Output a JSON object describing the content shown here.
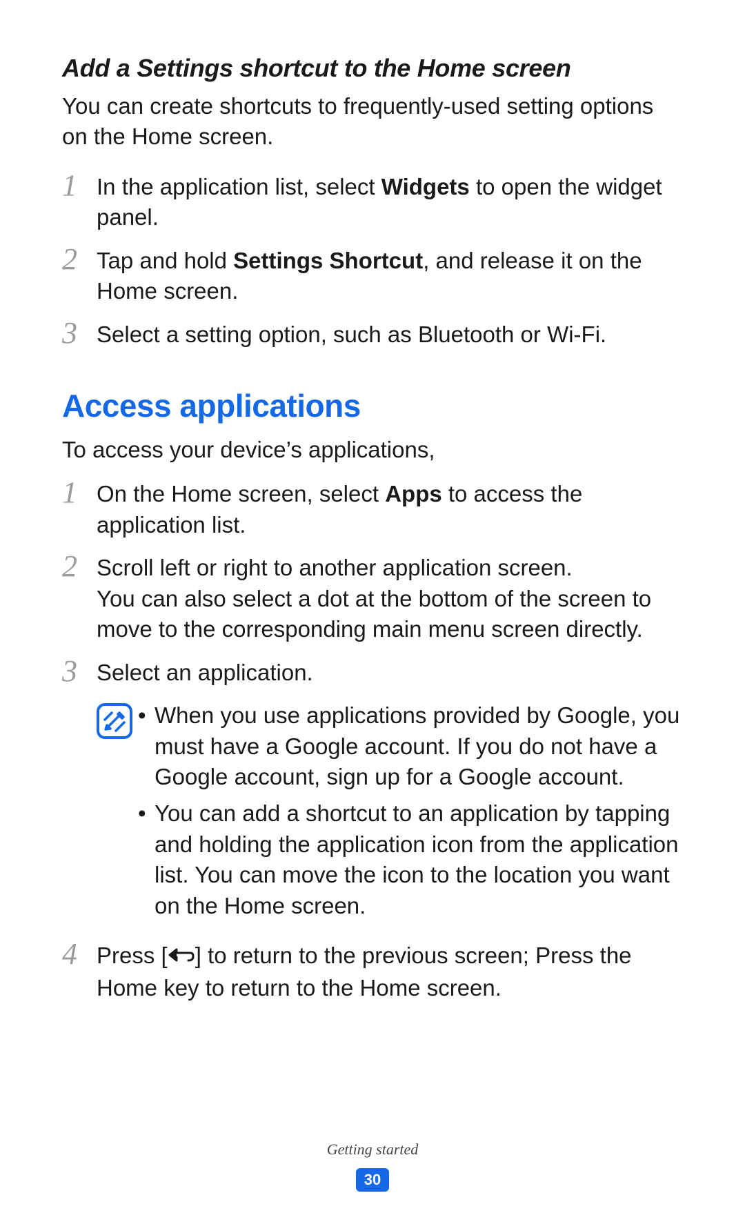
{
  "section1": {
    "heading": "Add a Settings shortcut to the Home screen",
    "intro": "You can create shortcuts to frequently-used setting options on the Home screen.",
    "steps": {
      "n1": "1",
      "s1_pre": "In the application list, select ",
      "s1_bold": "Widgets",
      "s1_post": " to open the widget panel.",
      "n2": "2",
      "s2_pre": "Tap and hold ",
      "s2_bold": "Settings Shortcut",
      "s2_post": ", and release it on the Home screen.",
      "n3": "3",
      "s3": "Select a setting option, such as Bluetooth or Wi-Fi."
    }
  },
  "section2": {
    "heading": "Access applications",
    "intro": "To access your device’s applications,",
    "steps": {
      "n1": "1",
      "s1_pre": "On the Home screen, select ",
      "s1_bold": "Apps",
      "s1_post": " to access the application list.",
      "n2": "2",
      "s2_line1": "Scroll left or right to another application screen.",
      "s2_line2": "You can also select a dot at the bottom of the screen to move to the corresponding main menu screen directly.",
      "n3": "3",
      "s3": "Select an application.",
      "n4": "4",
      "s4_pre": "Press [",
      "s4_post": "] to return to the previous screen; Press the Home key to return to the Home screen."
    },
    "notes": {
      "b1": "When you use applications provided by Google, you must have a Google account. If you do not have a Google account, sign up for a Google account.",
      "b2": "You can add a shortcut to an application by tapping and holding the application icon from the application list. You can move the icon to the location you want on the Home screen."
    }
  },
  "footer": {
    "chapter": "Getting started",
    "page": "30"
  },
  "glyphs": {
    "bullet": "•"
  }
}
